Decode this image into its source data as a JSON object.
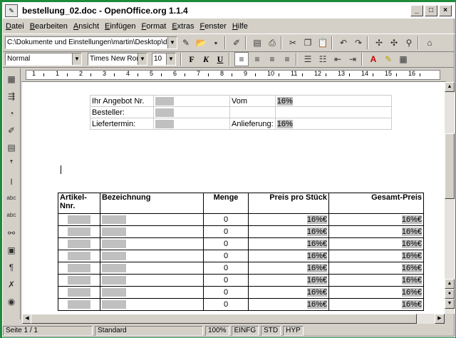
{
  "window": {
    "title": "bestellung_02.doc - OpenOffice.org 1.1.4"
  },
  "menu": [
    "Datei",
    "Bearbeiten",
    "Ansicht",
    "Einfügen",
    "Format",
    "Extras",
    "Fenster",
    "Hilfe"
  ],
  "toolbar": {
    "url_value": "C:\\Dokumente und Einstellungen\\martin\\Desktop\\downloa"
  },
  "format_bar": {
    "paragraph_style": "Normal",
    "font_name": "Times New Roma",
    "font_size": "10",
    "bold": "F",
    "italic": "K",
    "underline": "U"
  },
  "ruler": {
    "numbers": [
      "1",
      "1",
      "2",
      "3",
      "4",
      "5",
      "6",
      "7",
      "8",
      "9",
      "10",
      "11",
      "12",
      "13",
      "14",
      "15",
      "16"
    ]
  },
  "header_table": {
    "r1_label1": "Ihr Angebot Nr.",
    "r1_label2": "Vom",
    "r1_value2": "16%",
    "r2_label1": "Besteller:",
    "r3_label1": "Liefertermin:",
    "r3_label2": "Anlieferung:",
    "r3_value2": "16%"
  },
  "main_table": {
    "headers": [
      "Artikel-Nnr.",
      "Bezeichnung",
      "Menge",
      "Preis pro Stück",
      "Gesamt-Preis"
    ],
    "rows": [
      {
        "menge": "0",
        "preis": "16%€",
        "gesamt": "16%€"
      },
      {
        "menge": "0",
        "preis": "16%€",
        "gesamt": "16%€"
      },
      {
        "menge": "0",
        "preis": "16%€",
        "gesamt": "16%€"
      },
      {
        "menge": "0",
        "preis": "16%€",
        "gesamt": "16%€"
      },
      {
        "menge": "0",
        "preis": "16%€",
        "gesamt": "16%€"
      },
      {
        "menge": "0",
        "preis": "16%€",
        "gesamt": "16%€"
      },
      {
        "menge": "0",
        "preis": "16%€",
        "gesamt": "16%€"
      },
      {
        "menge": "0",
        "preis": "16%€",
        "gesamt": "16%€"
      }
    ]
  },
  "status": {
    "page": "Seite 1 / 1",
    "style": "Standard",
    "zoom": "100%",
    "insert_mode": "EINFG",
    "selection_mode": "STD",
    "hyperlink_mode": "HYP"
  }
}
